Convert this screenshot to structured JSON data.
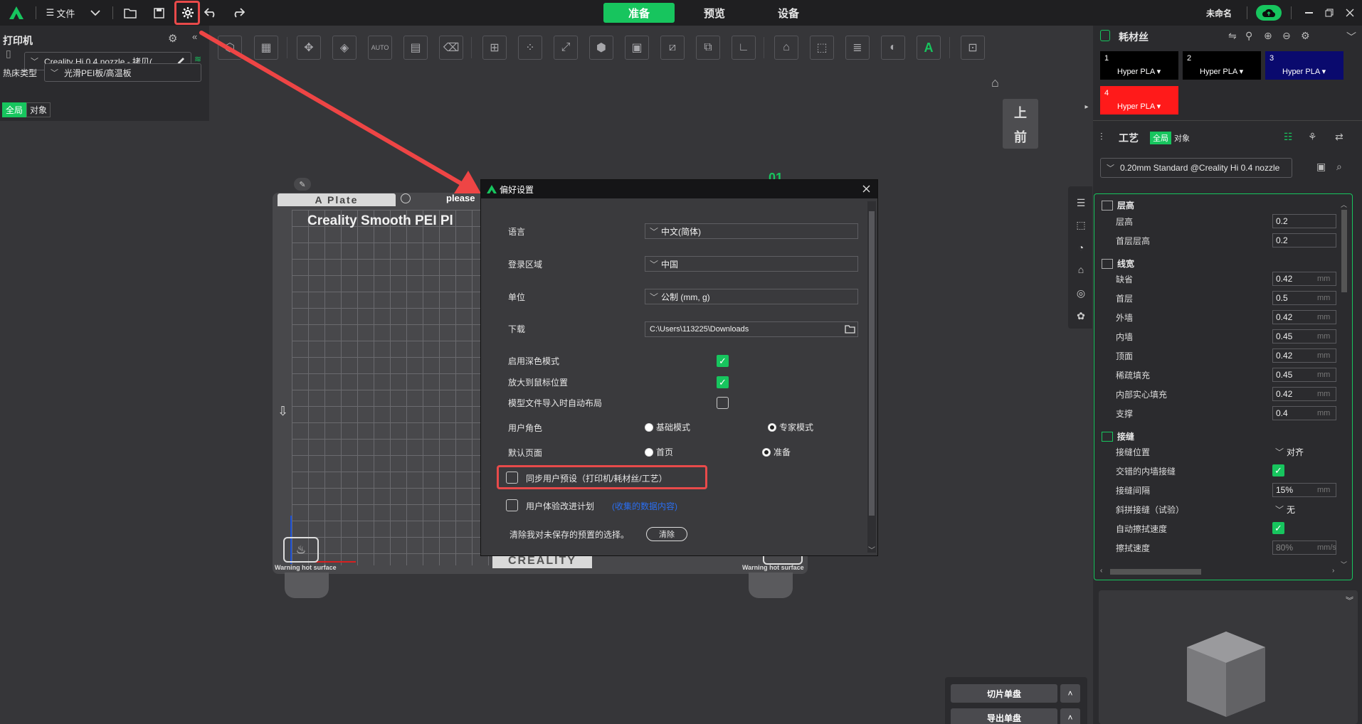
{
  "topbar": {
    "file_label": "文件",
    "tabs": [
      "准备",
      "预览",
      "设备"
    ],
    "active_tab": "准备",
    "project_name": "未命名"
  },
  "printer_panel": {
    "title": "打印机",
    "printer_name": "Creality Hi 0.4 nozzle - 拷贝(",
    "bed_type_label": "热床类型",
    "bed_type_value": "光滑PEI板/高温板",
    "scope_global": "全局",
    "scope_object": "对象"
  },
  "plate": {
    "tab_label": "A Plate",
    "title": "Creality Smooth PEI Pl",
    "notice": "please",
    "warning_left": "Warning hot surface",
    "warning_right": "Warning hot surface",
    "brand": "CREALITY",
    "plate_number": "01"
  },
  "view_cube": {
    "top": "上",
    "front": "前"
  },
  "dialog": {
    "title": "偏好设置",
    "language_label": "语言",
    "language_value": "中文(简体)",
    "region_label": "登录区域",
    "region_value": "中国",
    "unit_label": "单位",
    "unit_value": "公制 (mm, g)",
    "download_label": "下载",
    "download_path": "C:\\Users\\113225\\Downloads",
    "dark_mode_label": "启用深色模式",
    "dark_mode_checked": true,
    "zoom_mouse_label": "放大到鼠标位置",
    "zoom_mouse_checked": true,
    "auto_arrange_label": "模型文件导入时自动布局",
    "auto_arrange_checked": false,
    "user_role_label": "用户角色",
    "role_basic": "基础模式",
    "role_expert": "专家模式",
    "role_selected": "专家模式",
    "default_page_label": "默认页面",
    "page_home": "首页",
    "page_prepare": "准备",
    "page_selected": "准备",
    "sync_presets_label": "同步用户预设（打印机/耗材丝/工艺）",
    "sync_presets_checked": false,
    "ux_program_label": "用户体验改进计划",
    "ux_program_link": "(收集的数据内容)",
    "ux_program_checked": false,
    "clear_label": "清除我对未保存的预置的选择。",
    "clear_button": "清除"
  },
  "filament_panel": {
    "title": "耗材丝",
    "cards": [
      {
        "num": "1",
        "name": "Hyper PLA",
        "color": "#000000"
      },
      {
        "num": "2",
        "name": "Hyper PLA",
        "color": "#000000"
      },
      {
        "num": "3",
        "name": "Hyper PLA",
        "color": "#0a0a6e"
      },
      {
        "num": "4",
        "name": "Hyper PLA",
        "color": "#ff1a1a"
      }
    ]
  },
  "process_panel": {
    "title": "工艺",
    "scope_global": "全局",
    "scope_object": "对象",
    "preset": "0.20mm Standard @Creality Hi 0.4 nozzle"
  },
  "properties": {
    "sections": [
      {
        "title": "层高",
        "rows": [
          {
            "label": "层高",
            "value": "0.2",
            "unit": ""
          },
          {
            "label": "首层层高",
            "value": "0.2",
            "unit": ""
          }
        ]
      },
      {
        "title": "线宽",
        "rows": [
          {
            "label": "缺省",
            "value": "0.42",
            "unit": "mm"
          },
          {
            "label": "首层",
            "value": "0.5",
            "unit": "mm"
          },
          {
            "label": "外墙",
            "value": "0.42",
            "unit": "mm"
          },
          {
            "label": "内墙",
            "value": "0.45",
            "unit": "mm"
          },
          {
            "label": "顶面",
            "value": "0.42",
            "unit": "mm"
          },
          {
            "label": "稀疏填充",
            "value": "0.45",
            "unit": "mm"
          },
          {
            "label": "内部实心填充",
            "value": "0.42",
            "unit": "mm"
          },
          {
            "label": "支撑",
            "value": "0.4",
            "unit": "mm"
          }
        ]
      },
      {
        "title": "接缝",
        "rows": [
          {
            "label": "接缝位置",
            "value": "对齐",
            "unit": ""
          },
          {
            "label": "交错的内墙接缝",
            "value": "",
            "unit": ""
          },
          {
            "label": "接缝间隔",
            "value": "15%",
            "unit": "mm"
          },
          {
            "label": "斜拼接缝（试验）",
            "value": "无",
            "unit": ""
          },
          {
            "label": "自动擦拭速度",
            "value": "",
            "unit": ""
          },
          {
            "label": "擦拭速度",
            "value": "80%",
            "unit": "mm/s"
          }
        ]
      }
    ]
  },
  "bottom_buttons": {
    "slice": "切片单盘",
    "export": "导出单盘"
  },
  "colors": {
    "accent": "#17c55e",
    "highlight": "#e84a4a"
  }
}
